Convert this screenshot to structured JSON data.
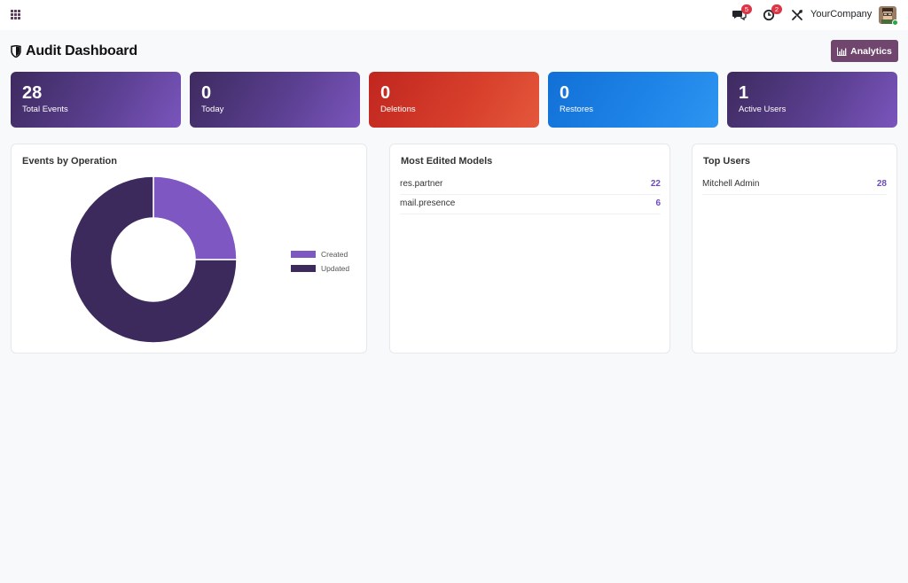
{
  "topbar": {
    "company": "YourCompany",
    "chat_badge": "5",
    "activity_badge": "2",
    "icons": [
      "apps-icon",
      "chat-icon",
      "activity-icon",
      "tools-icon"
    ]
  },
  "page": {
    "title": "Audit Dashboard",
    "analytics_label": "Analytics"
  },
  "stats": [
    {
      "value": "28",
      "label": "Total Events",
      "color": "#5a3f90"
    },
    {
      "value": "0",
      "label": "Today",
      "color": "#5a3f90"
    },
    {
      "value": "0",
      "label": "Deletions",
      "color": "#d8402c"
    },
    {
      "value": "0",
      "label": "Restores",
      "color": "#1f85e8"
    },
    {
      "value": "1",
      "label": "Active Users",
      "color": "#5a3f90"
    }
  ],
  "panels": {
    "operations_title": "Events by Operation",
    "models_title": "Most Edited Models",
    "users_title": "Top Users"
  },
  "models": [
    {
      "name": "res.partner",
      "count": "22"
    },
    {
      "name": "mail.presence",
      "count": "6"
    }
  ],
  "users": [
    {
      "name": "Mitchell Admin",
      "count": "28"
    }
  ],
  "chart_data": {
    "type": "pie",
    "categories": [
      "Created",
      "Updated"
    ],
    "values": [
      7,
      21
    ],
    "colors": [
      "#7e57c2",
      "#3d2a5c"
    ],
    "title": "Events by Operation",
    "legend": "right",
    "donut": true
  }
}
